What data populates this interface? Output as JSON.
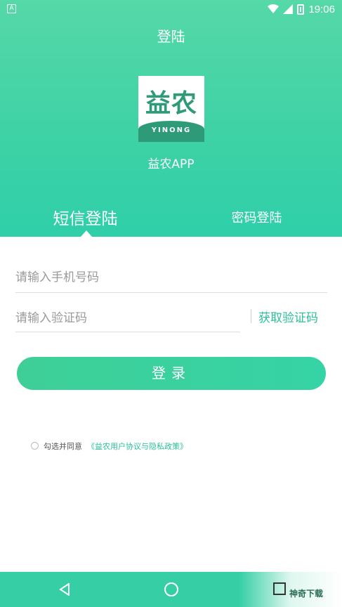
{
  "status": {
    "time": "19:06"
  },
  "header": {
    "title": "登陆"
  },
  "logo": {
    "main_text": "益农",
    "sub_text": "YINONG"
  },
  "app": {
    "name": "益农APP"
  },
  "tabs": [
    {
      "label": "短信登陆",
      "active": true
    },
    {
      "label": "密码登陆",
      "active": false
    }
  ],
  "form": {
    "phone_placeholder": "请输入手机号码",
    "code_placeholder": "请输入验证码",
    "get_code_label": "获取验证码",
    "login_label": "登录"
  },
  "agreement": {
    "prefix": "勾选并同意",
    "link": "《益农用户协议与隐私政策》"
  },
  "watermark": {
    "text": "神奇下载"
  },
  "colors": {
    "accent": "#36d3a6",
    "link": "#2cc09a"
  }
}
